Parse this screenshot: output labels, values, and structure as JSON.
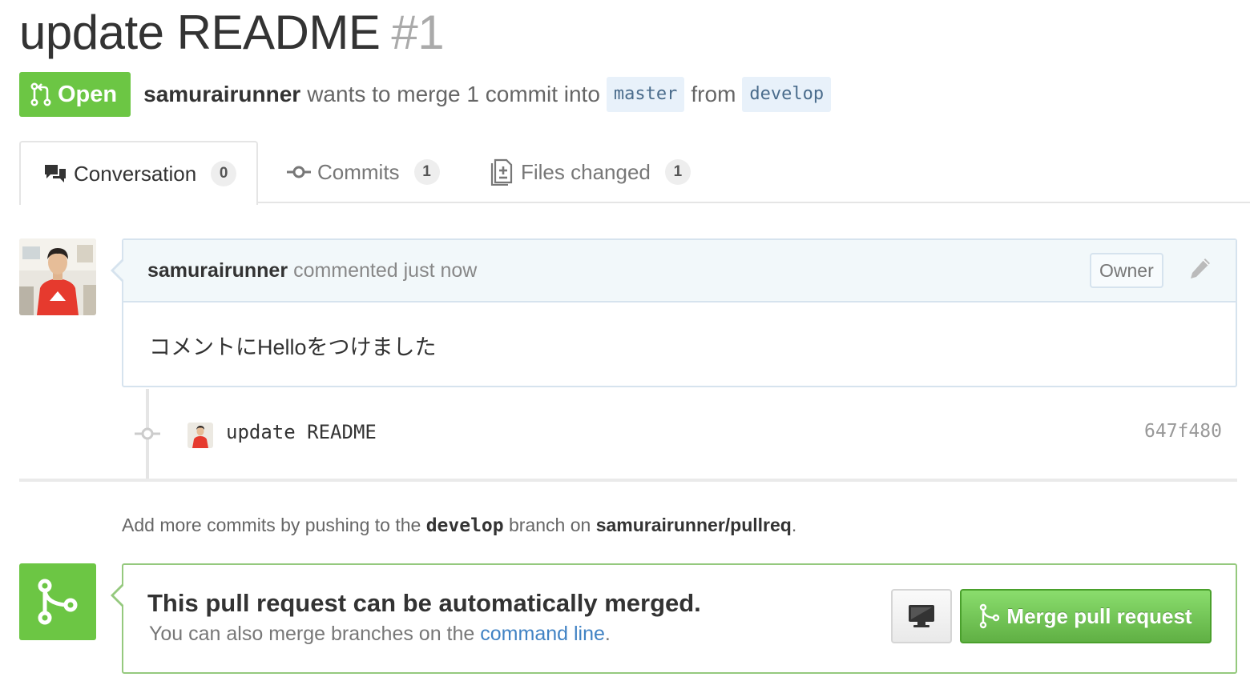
{
  "pr": {
    "title": "update README",
    "number": "#1",
    "state": "Open",
    "author": "samurairunner",
    "merge_text": "wants to merge 1 commit into",
    "base_branch": "master",
    "from_text": "from",
    "head_branch": "develop"
  },
  "tabs": [
    {
      "label": "Conversation",
      "count": "0",
      "icon": "comment-discussion-icon"
    },
    {
      "label": "Commits",
      "count": "1",
      "icon": "git-commit-icon"
    },
    {
      "label": "Files changed",
      "count": "1",
      "icon": "diff-icon"
    }
  ],
  "comment": {
    "author": "samurairunner",
    "action": "commented just now",
    "role": "Owner",
    "body": "コメントにHelloをつけました"
  },
  "commit": {
    "message": "update README",
    "sha": "647f480"
  },
  "help": {
    "prefix": "Add more commits by pushing to the",
    "branch": "develop",
    "middle": "branch on",
    "repo": "samurairunner/pullreq",
    "suffix": "."
  },
  "merge": {
    "title": "This pull request can be automatically merged.",
    "sub_prefix": "You can also merge branches on the",
    "sub_link": "command line",
    "sub_suffix": ".",
    "button_label": "Merge pull request"
  },
  "colors": {
    "open_green": "#6cc644",
    "link_blue": "#4183c4",
    "branch_bg": "#e8f1fa"
  }
}
